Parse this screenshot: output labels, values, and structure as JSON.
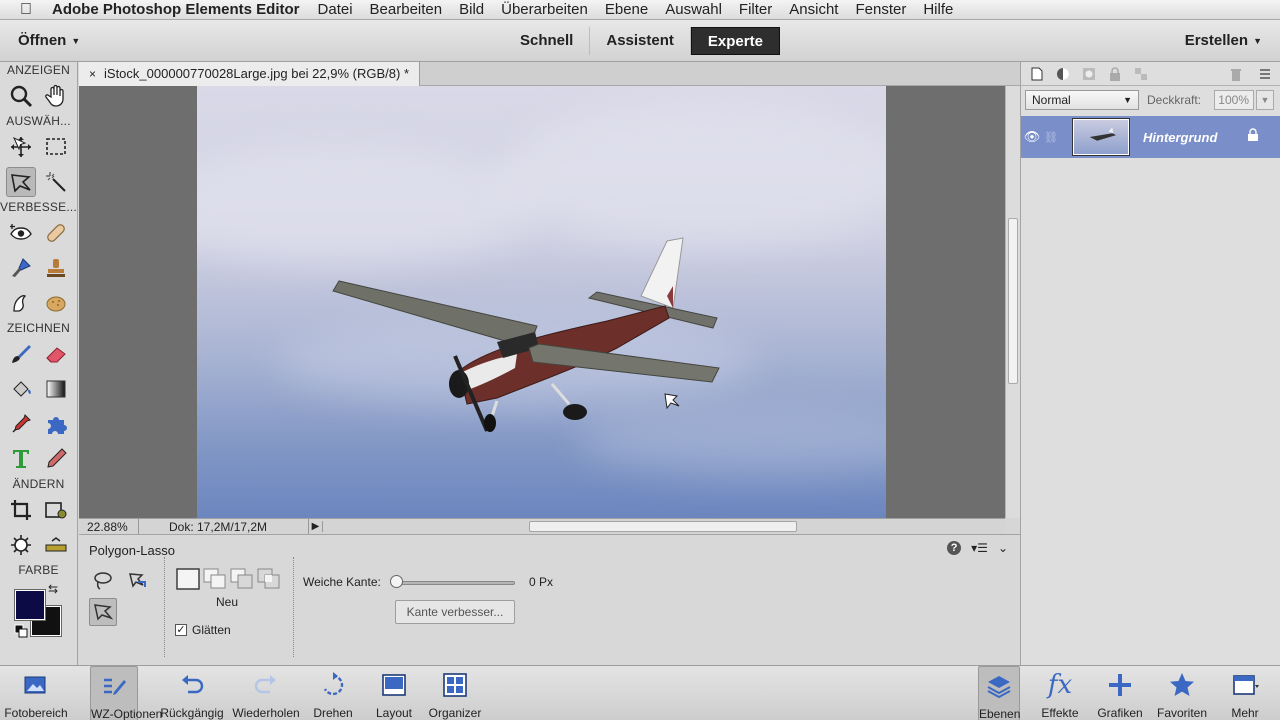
{
  "menubar": {
    "app_name": "Adobe Photoshop Elements Editor",
    "items": [
      "Datei",
      "Bearbeiten",
      "Bild",
      "Überarbeiten",
      "Ebene",
      "Auswahl",
      "Filter",
      "Ansicht",
      "Fenster",
      "Hilfe"
    ]
  },
  "topbar": {
    "open_label": "Öffnen",
    "modes": [
      "Schnell",
      "Assistent",
      "Experte"
    ],
    "active_mode": "Experte",
    "create_label": "Erstellen"
  },
  "tools": {
    "sections": {
      "view": "ANZEIGEN",
      "select": "AUSWÄH...",
      "enhance": "VERBESSE...",
      "draw": "ZEICHNEN",
      "modify": "ÄNDERN",
      "color": "FARBE"
    },
    "selected_tool": "polygon-lasso",
    "foreground_color": "#0d0b45",
    "background_color": "#111111"
  },
  "document": {
    "tab_title": "iStock_000000770028Large.jpg bei 22,9% (RGB/8) *",
    "close_glyph": "×",
    "zoom": "22.88%",
    "doc_size": "Dok: 17,2M/17,2M"
  },
  "options": {
    "title": "Polygon-Lasso",
    "selection_mode_label": "Neu",
    "smooth_label": "Glätten",
    "smooth_checked": true,
    "feather_label": "Weiche Kante:",
    "feather_value": "0 Px",
    "refine_button": "Kante verbesser..."
  },
  "layers": {
    "blend_mode": "Normal",
    "opacity_label": "Deckkraft:",
    "opacity_value": "100%",
    "layer_name": "Hintergrund"
  },
  "bottombar": {
    "left": [
      "Fotobereich",
      "WZ-Optionen",
      "Rückgängig",
      "Wiederholen",
      "Drehen",
      "Layout",
      "Organizer"
    ],
    "right": [
      "Ebenen",
      "Effekte",
      "Grafiken",
      "Favoriten",
      "Mehr"
    ]
  }
}
